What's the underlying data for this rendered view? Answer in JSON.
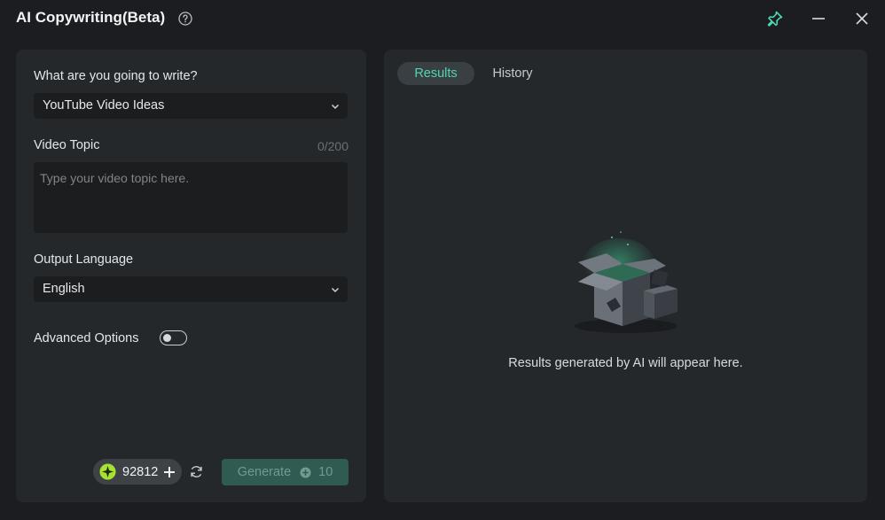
{
  "window": {
    "title": "AI Copywriting(Beta)"
  },
  "form": {
    "write_label": "What are you going to write?",
    "write_value": "YouTube Video Ideas",
    "topic_label": "Video Topic",
    "topic_counter": "0/200",
    "topic_placeholder": "Type your video topic here.",
    "language_label": "Output Language",
    "language_value": "English",
    "advanced_label": "Advanced Options",
    "advanced_enabled": false
  },
  "footer": {
    "credits": "92812",
    "generate_label": "Generate",
    "generate_cost": "10"
  },
  "results": {
    "tabs": [
      {
        "label": "Results",
        "active": true
      },
      {
        "label": "History",
        "active": false
      }
    ],
    "empty_message": "Results generated by AI will appear here."
  },
  "colors": {
    "accent": "#4fd6b5",
    "background": "#1b1d20",
    "panel": "#25282b",
    "generate_disabled": "#2f5b52",
    "credit_icon": "#a6e22e"
  },
  "icons": [
    "help-icon",
    "pin-icon",
    "minimize-icon",
    "close-icon",
    "chevron-down-icon",
    "credit-coin-icon",
    "plus-icon",
    "refresh-icon",
    "coin-icon",
    "empty-box-illustration"
  ]
}
